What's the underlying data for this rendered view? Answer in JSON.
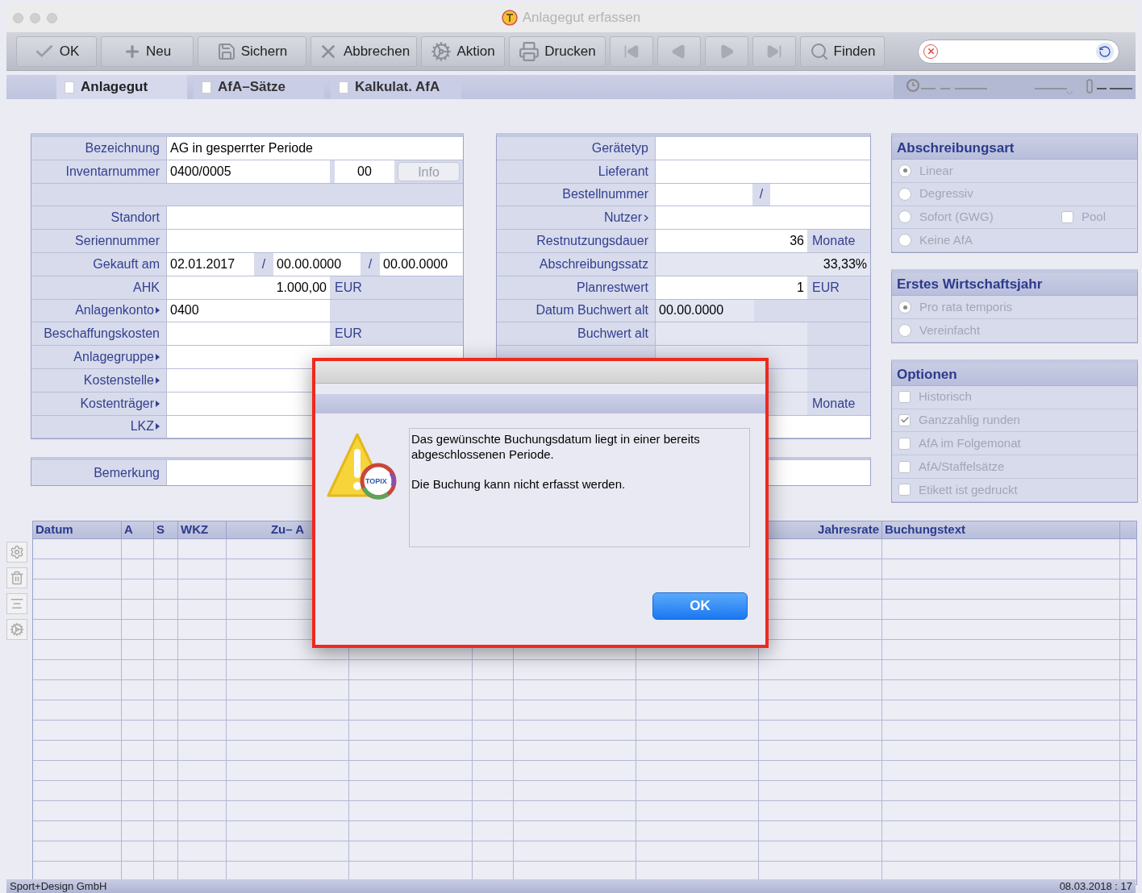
{
  "window": {
    "title": "Anlagegut erfassen"
  },
  "toolbar": [
    {
      "kind": "ok",
      "label": "OK"
    },
    {
      "kind": "new",
      "label": "Neu"
    },
    {
      "kind": "save",
      "label": "Sichern"
    },
    {
      "kind": "cancel",
      "label": "Abbrechen"
    },
    {
      "kind": "action",
      "label": "Aktion"
    },
    {
      "kind": "print",
      "label": "Drucken"
    },
    {
      "kind": "first"
    },
    {
      "kind": "prev"
    },
    {
      "kind": "next"
    },
    {
      "kind": "last"
    },
    {
      "kind": "find",
      "label": "Finden"
    }
  ],
  "tabs": [
    {
      "label": "Anlagegut",
      "selected": true
    },
    {
      "label": "AfA–Sätze",
      "selected": false
    },
    {
      "label": "Kalkulat. AfA",
      "selected": false
    }
  ],
  "left_form": [
    {
      "kind": "text",
      "label": "Bezeichnung",
      "value": "AG in gesperrter Periode"
    },
    {
      "kind": "inventory",
      "label": "Inventarnummer",
      "value": "0400/0005",
      "suffix": "00",
      "button": "Info"
    },
    {
      "kind": "spacer"
    },
    {
      "kind": "text",
      "label": "Standort"
    },
    {
      "kind": "text",
      "label": "Seriennummer"
    },
    {
      "kind": "dates",
      "label": "Gekauft am",
      "values": [
        "02.01.2017",
        "00.00.0000",
        "00.00.0000"
      ],
      "separators": [
        "/",
        "/"
      ]
    },
    {
      "kind": "amount",
      "label": "AHK",
      "value": "1.000,00",
      "unit": "EUR"
    },
    {
      "kind": "account",
      "label": "Anlagenkonto",
      "menu": true,
      "value": "0400"
    },
    {
      "kind": "amount",
      "label": "Beschaffungskosten",
      "unit": "EUR"
    },
    {
      "kind": "text",
      "label": "Anlagegruppe",
      "menu": true
    },
    {
      "kind": "text",
      "label": "Kostenstelle",
      "menu": true
    },
    {
      "kind": "text",
      "label": "Kostenträger",
      "menu": true
    },
    {
      "kind": "text",
      "label": "LKZ",
      "menu": true
    }
  ],
  "middle_form": [
    {
      "kind": "text",
      "label": "Gerätetyp"
    },
    {
      "kind": "text",
      "label": "Lieferant"
    },
    {
      "kind": "split",
      "label": "Bestellnummer",
      "separator": "/"
    },
    {
      "kind": "text",
      "label": "Nutzer",
      "menu": true
    },
    {
      "kind": "amount",
      "label": "Restnutzungsdauer",
      "value": "36",
      "unit": "Monate"
    },
    {
      "kind": "readout",
      "label": "Abschreibungssatz",
      "value": "33,33%"
    },
    {
      "kind": "amount",
      "label": "Planrestwert",
      "value": "1",
      "unit": "EUR"
    },
    {
      "kind": "date",
      "label": "Datum Buchwert alt",
      "value": "00.00.0000"
    },
    {
      "kind": "readonly",
      "label": "Buchwert alt"
    },
    {
      "kind": "readonly"
    },
    {
      "kind": "readonly"
    },
    {
      "kind": "readonly",
      "unit": "Monate"
    },
    {
      "kind": "text"
    }
  ],
  "remark": {
    "label": "Bemerkung"
  },
  "panels": [
    {
      "title": "Abschreibungsart",
      "options": [
        {
          "kind": "radio",
          "label": "Linear",
          "selected": true,
          "disabled": true
        },
        {
          "kind": "radio",
          "label": "Degressiv",
          "selected": false,
          "disabled": true
        },
        {
          "kind": "radio",
          "label": "Sofort (GWG)",
          "selected": false,
          "disabled": true,
          "extra": {
            "label": "Pool",
            "checked": false
          }
        },
        {
          "kind": "radio",
          "label": "Keine AfA",
          "selected": false,
          "disabled": true
        }
      ]
    },
    {
      "title": "Erstes Wirtschaftsjahr",
      "options": [
        {
          "kind": "radio",
          "label": "Pro rata temporis",
          "selected": true,
          "disabled": true
        },
        {
          "kind": "radio",
          "label": "Vereinfacht",
          "selected": false,
          "disabled": true
        }
      ]
    },
    {
      "title": "Optionen",
      "options": [
        {
          "kind": "check",
          "label": "Historisch",
          "checked": false,
          "disabled": true
        },
        {
          "kind": "check",
          "label": "Ganzzahlig runden",
          "checked": true,
          "disabled": true
        },
        {
          "kind": "check",
          "label": "AfA im Folgemonat",
          "checked": false,
          "disabled": true
        },
        {
          "kind": "check",
          "label": "AfA/Staffelsätze",
          "checked": false,
          "disabled": true
        },
        {
          "kind": "check",
          "label": "Etikett ist gedruckt",
          "checked": false,
          "disabled": true
        }
      ]
    }
  ],
  "table": {
    "columns": [
      "Datum",
      "A",
      "S",
      "WKZ",
      "Zu– A",
      null,
      null,
      null,
      null,
      "Jahresrate",
      "Buchungstext"
    ]
  },
  "dialog": {
    "logo_text": "TOPIX",
    "message": [
      "Das gewünschte Buchungsdatum liegt in einer bereits abgeschlossenen Periode.",
      "Die Buchung kann nicht erfasst werden."
    ],
    "button": "OK"
  },
  "status_bar": {
    "left": "Sport+Design GmbH",
    "right": "08.03.2018 : 17"
  }
}
